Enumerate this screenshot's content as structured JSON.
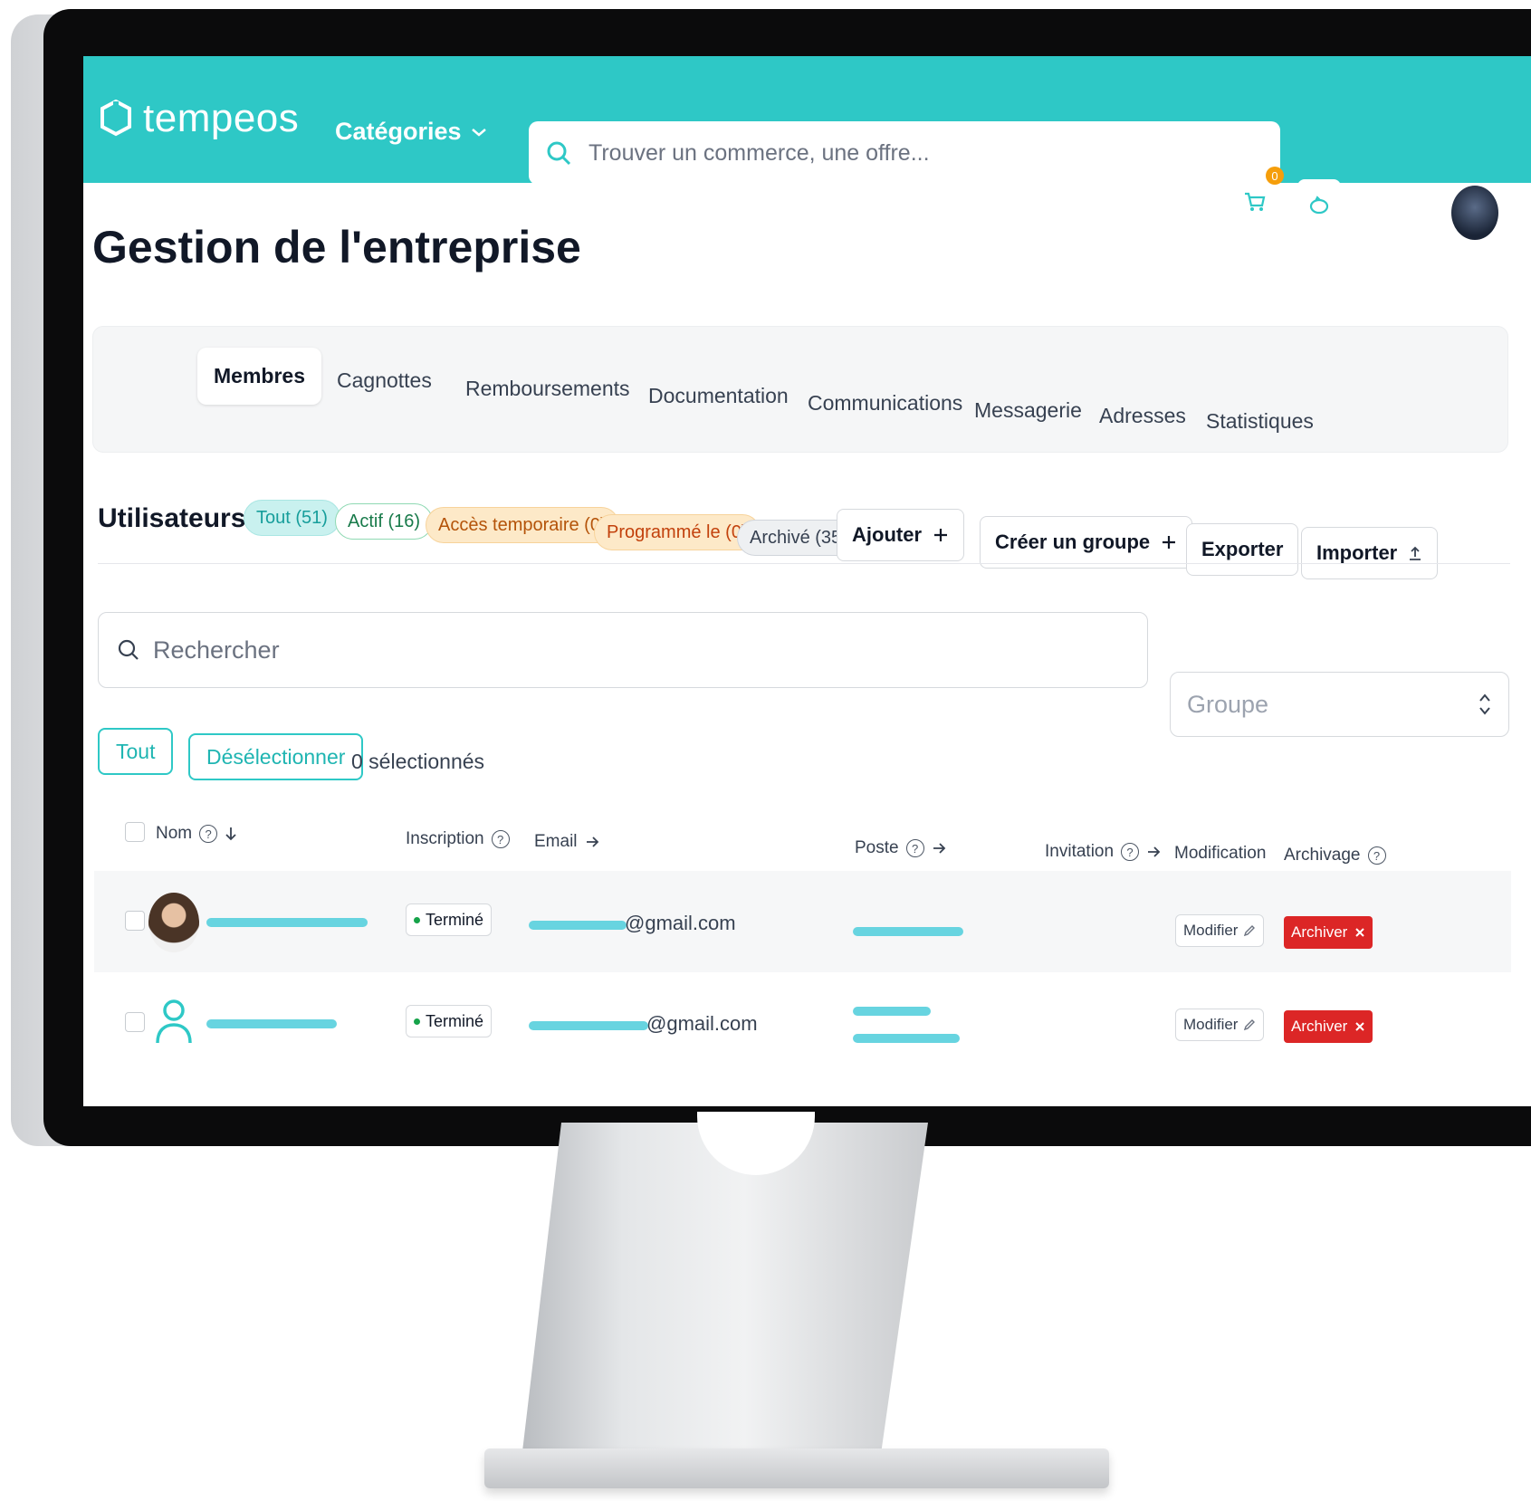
{
  "header": {
    "logo_text": "tempeos",
    "categories_label": "Catégories",
    "search_placeholder": "Trouver un commerce, une offre...",
    "cart_count": "0"
  },
  "page": {
    "title": "Gestion de l'entreprise"
  },
  "tabs": [
    {
      "label": "Membres",
      "active": true
    },
    {
      "label": "Cagnottes"
    },
    {
      "label": "Remboursements"
    },
    {
      "label": "Documentation"
    },
    {
      "label": "Communications"
    },
    {
      "label": "Messagerie"
    },
    {
      "label": "Adresses"
    },
    {
      "label": "Statistiques"
    }
  ],
  "users": {
    "title": "Utilisateurs",
    "filters": {
      "all": "Tout (51)",
      "active": "Actif (16)",
      "temporary": "Accès temporaire (0)",
      "scheduled": "Programmé le (0)",
      "archived": "Archivé (35)"
    },
    "actions": {
      "add": "Ajouter",
      "create_group": "Créer un groupe",
      "export": "Exporter",
      "import": "Importer"
    },
    "search_placeholder": "Rechercher",
    "group_placeholder": "Groupe",
    "select_all": "Tout",
    "deselect": "Désélectionner",
    "selected_count": "0 sélectionnés"
  },
  "table": {
    "columns": {
      "name": "Nom",
      "registration": "Inscription",
      "email": "Email",
      "position": "Poste",
      "invitation": "Invitation",
      "modification": "Modification",
      "archiving": "Archivage"
    },
    "rows": [
      {
        "status": "Terminé",
        "email_suffix": "@gmail.com",
        "modify": "Modifier",
        "archive": "Archiver"
      },
      {
        "status": "Terminé",
        "email_suffix": "@gmail.com",
        "modify": "Modifier",
        "archive": "Archiver"
      }
    ]
  },
  "colors": {
    "brand": "#2ec8c6",
    "archive": "#dc2626",
    "badge": "#f59e0b"
  }
}
